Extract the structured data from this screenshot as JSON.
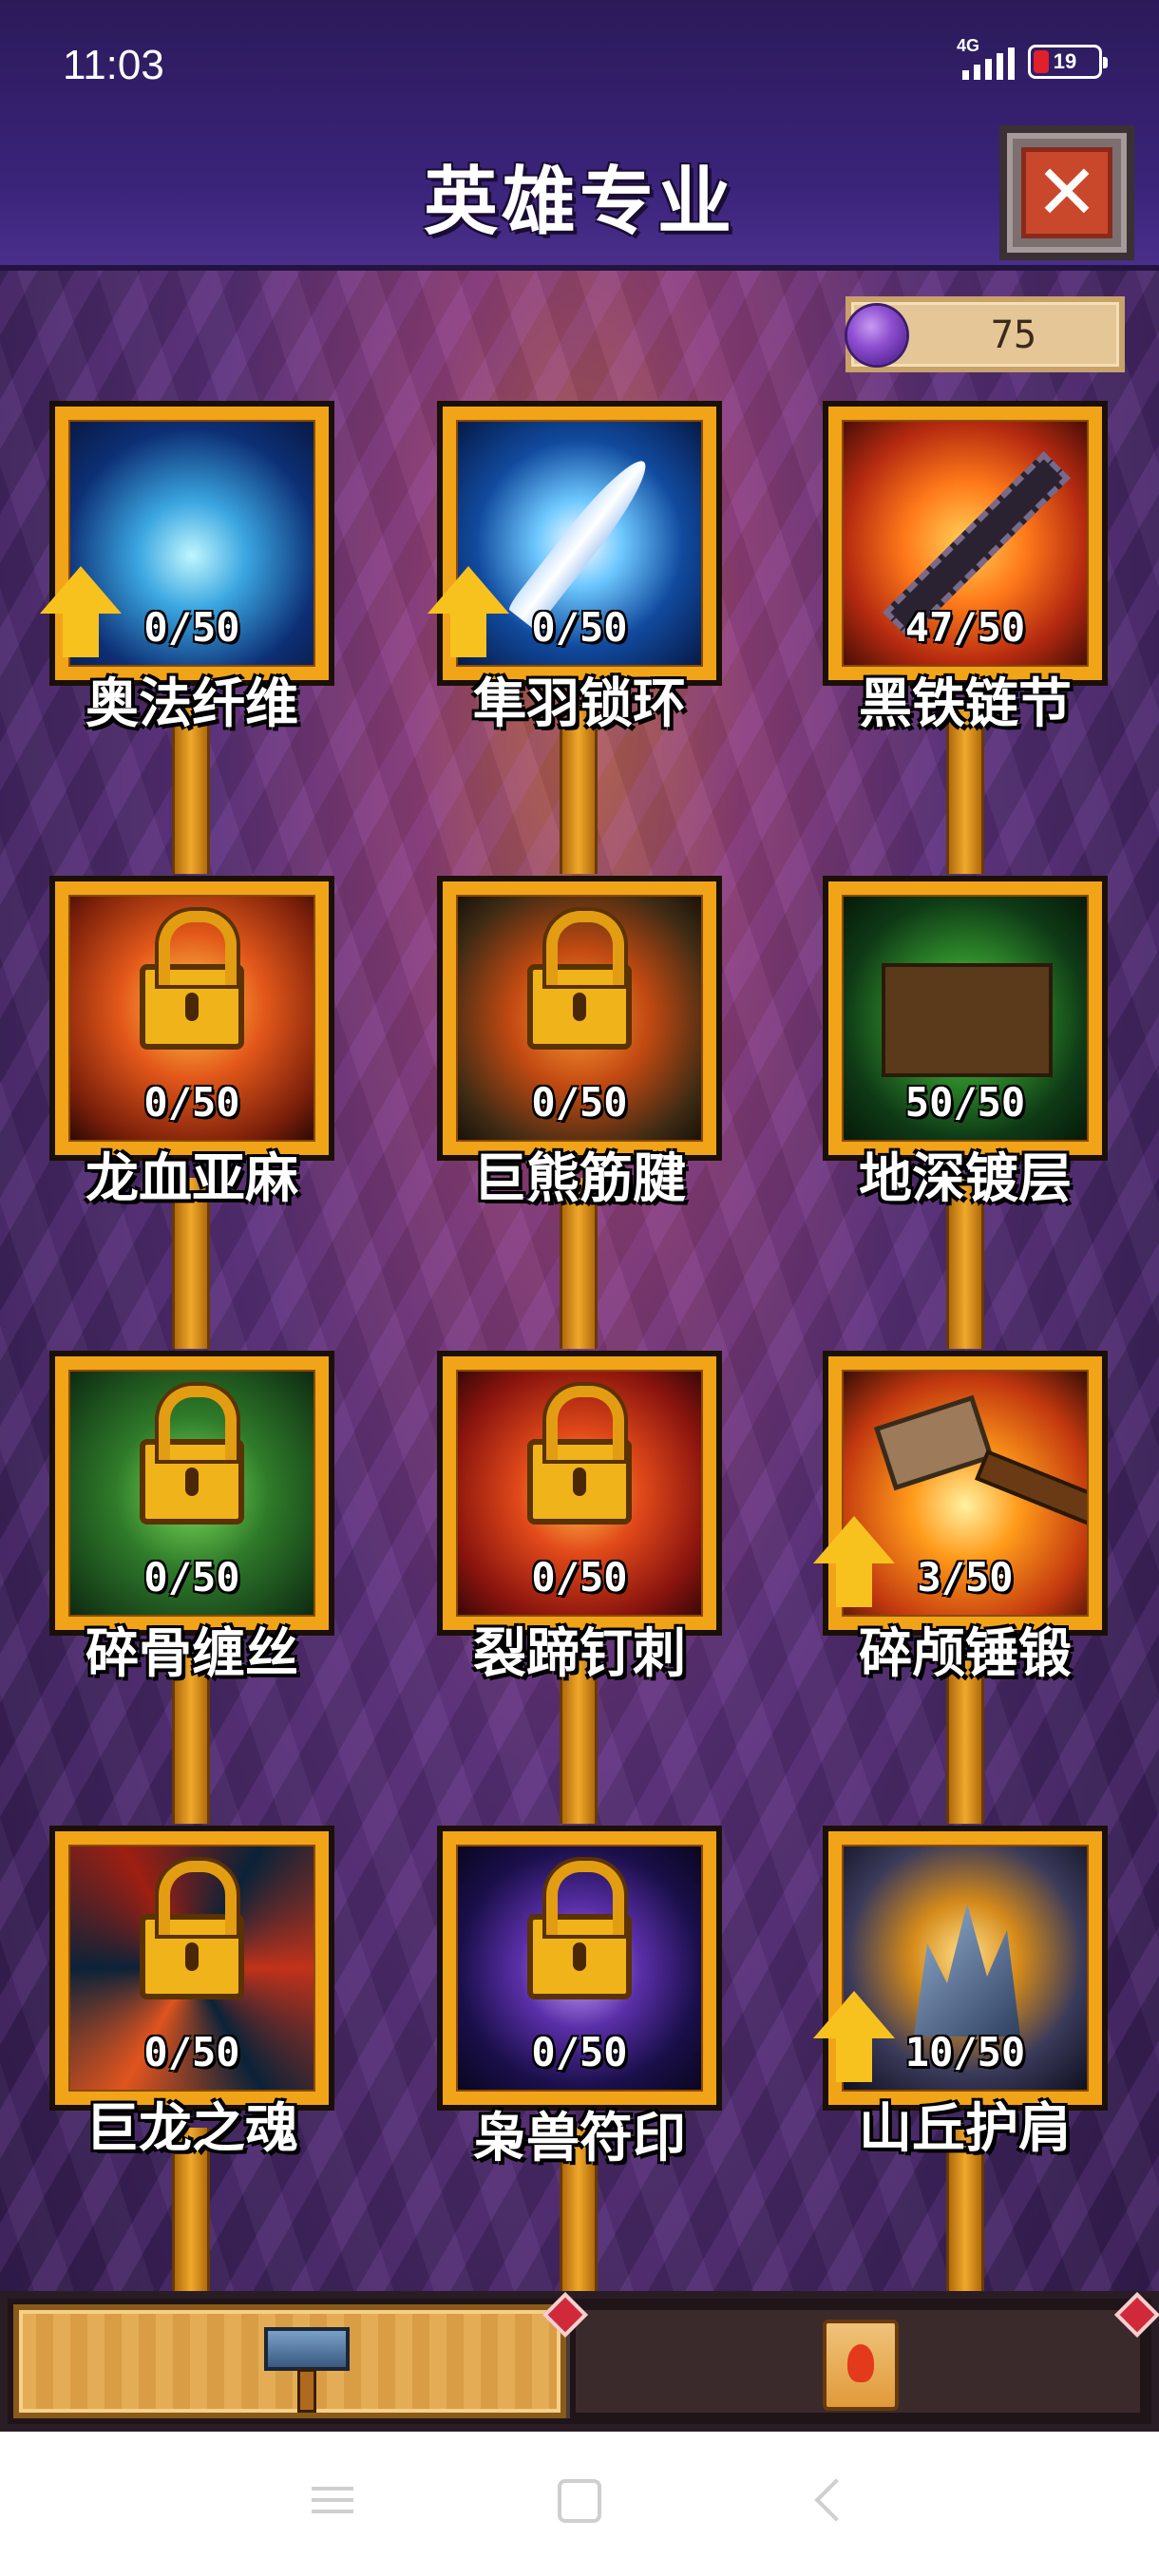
{
  "status_bar": {
    "time": "11:03",
    "network": "4G",
    "battery": "19"
  },
  "header": {
    "title": "英雄专业",
    "close_icon": "close-icon"
  },
  "currency": {
    "icon": "purple-gem-icon",
    "amount": "75"
  },
  "skills": [
    {
      "name": "奥法纤维",
      "level": "0/50",
      "locked": false,
      "upgradable": true,
      "art": "arcane-fiber-icon"
    },
    {
      "name": "隼羽锁环",
      "level": "0/50",
      "locked": false,
      "upgradable": true,
      "art": "feather-icon"
    },
    {
      "name": "黑铁链节",
      "level": "47/50",
      "locked": false,
      "upgradable": false,
      "art": "chain-icon"
    },
    {
      "name": "龙血亚麻",
      "level": "0/50",
      "locked": true,
      "upgradable": false,
      "art": "lock-icon"
    },
    {
      "name": "巨熊筋腱",
      "level": "0/50",
      "locked": true,
      "upgradable": false,
      "art": "lock-icon"
    },
    {
      "name": "地深镀层",
      "level": "50/50",
      "locked": false,
      "upgradable": false,
      "art": "earth-crack-icon"
    },
    {
      "name": "碎骨缠丝",
      "level": "0/50",
      "locked": true,
      "upgradable": false,
      "art": "lock-icon"
    },
    {
      "name": "裂蹄钉刺",
      "level": "0/50",
      "locked": true,
      "upgradable": false,
      "art": "lock-icon"
    },
    {
      "name": "碎颅锤锻",
      "level": "3/50",
      "locked": false,
      "upgradable": true,
      "art": "hammer-icon"
    },
    {
      "name": "巨龙之魂",
      "level": "0/50",
      "locked": true,
      "upgradable": false,
      "art": "lock-icon"
    },
    {
      "name": "枭兽符印",
      "level": "0/50",
      "locked": true,
      "upgradable": false,
      "art": "lock-icon"
    },
    {
      "name": "山丘护肩",
      "level": "10/50",
      "locked": false,
      "upgradable": true,
      "art": "crystal-shoulder-icon"
    }
  ],
  "tabs": [
    {
      "icon": "hammer-icon",
      "active": true
    },
    {
      "icon": "scroll-icon",
      "active": false
    }
  ],
  "nav": {
    "menu": "menu-icon",
    "home": "home-icon",
    "back": "back-icon"
  }
}
